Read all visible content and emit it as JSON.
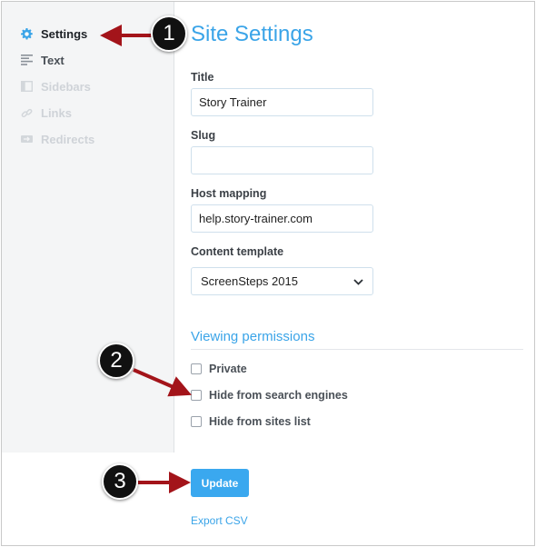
{
  "sidebar": {
    "items": [
      {
        "label": "Settings",
        "icon": "gear-icon",
        "state": "active"
      },
      {
        "label": "Text",
        "icon": "text-lines-icon",
        "state": "normal"
      },
      {
        "label": "Sidebars",
        "icon": "sidebar-icon",
        "state": "disabled"
      },
      {
        "label": "Links",
        "icon": "link-icon",
        "state": "disabled"
      },
      {
        "label": "Redirects",
        "icon": "redirect-icon",
        "state": "disabled"
      }
    ]
  },
  "main": {
    "title": "Site Settings",
    "fields": {
      "title": {
        "label": "Title",
        "value": "Story Trainer"
      },
      "slug": {
        "label": "Slug",
        "value": ""
      },
      "host_mapping": {
        "label": "Host mapping",
        "value": "help.story-trainer.com"
      },
      "content_template": {
        "label": "Content template",
        "value": "ScreenSteps 2015"
      }
    },
    "viewing_permissions": {
      "title": "Viewing permissions",
      "options": [
        {
          "label": "Private",
          "checked": false
        },
        {
          "label": "Hide from search engines",
          "checked": false
        },
        {
          "label": "Hide from sites list",
          "checked": false
        }
      ]
    },
    "update_label": "Update",
    "export_label": "Export CSV"
  },
  "callouts": [
    "1",
    "2",
    "3"
  ],
  "colors": {
    "accent": "#3aa4e8",
    "arrow": "#a3141a",
    "badge": "#111111"
  }
}
